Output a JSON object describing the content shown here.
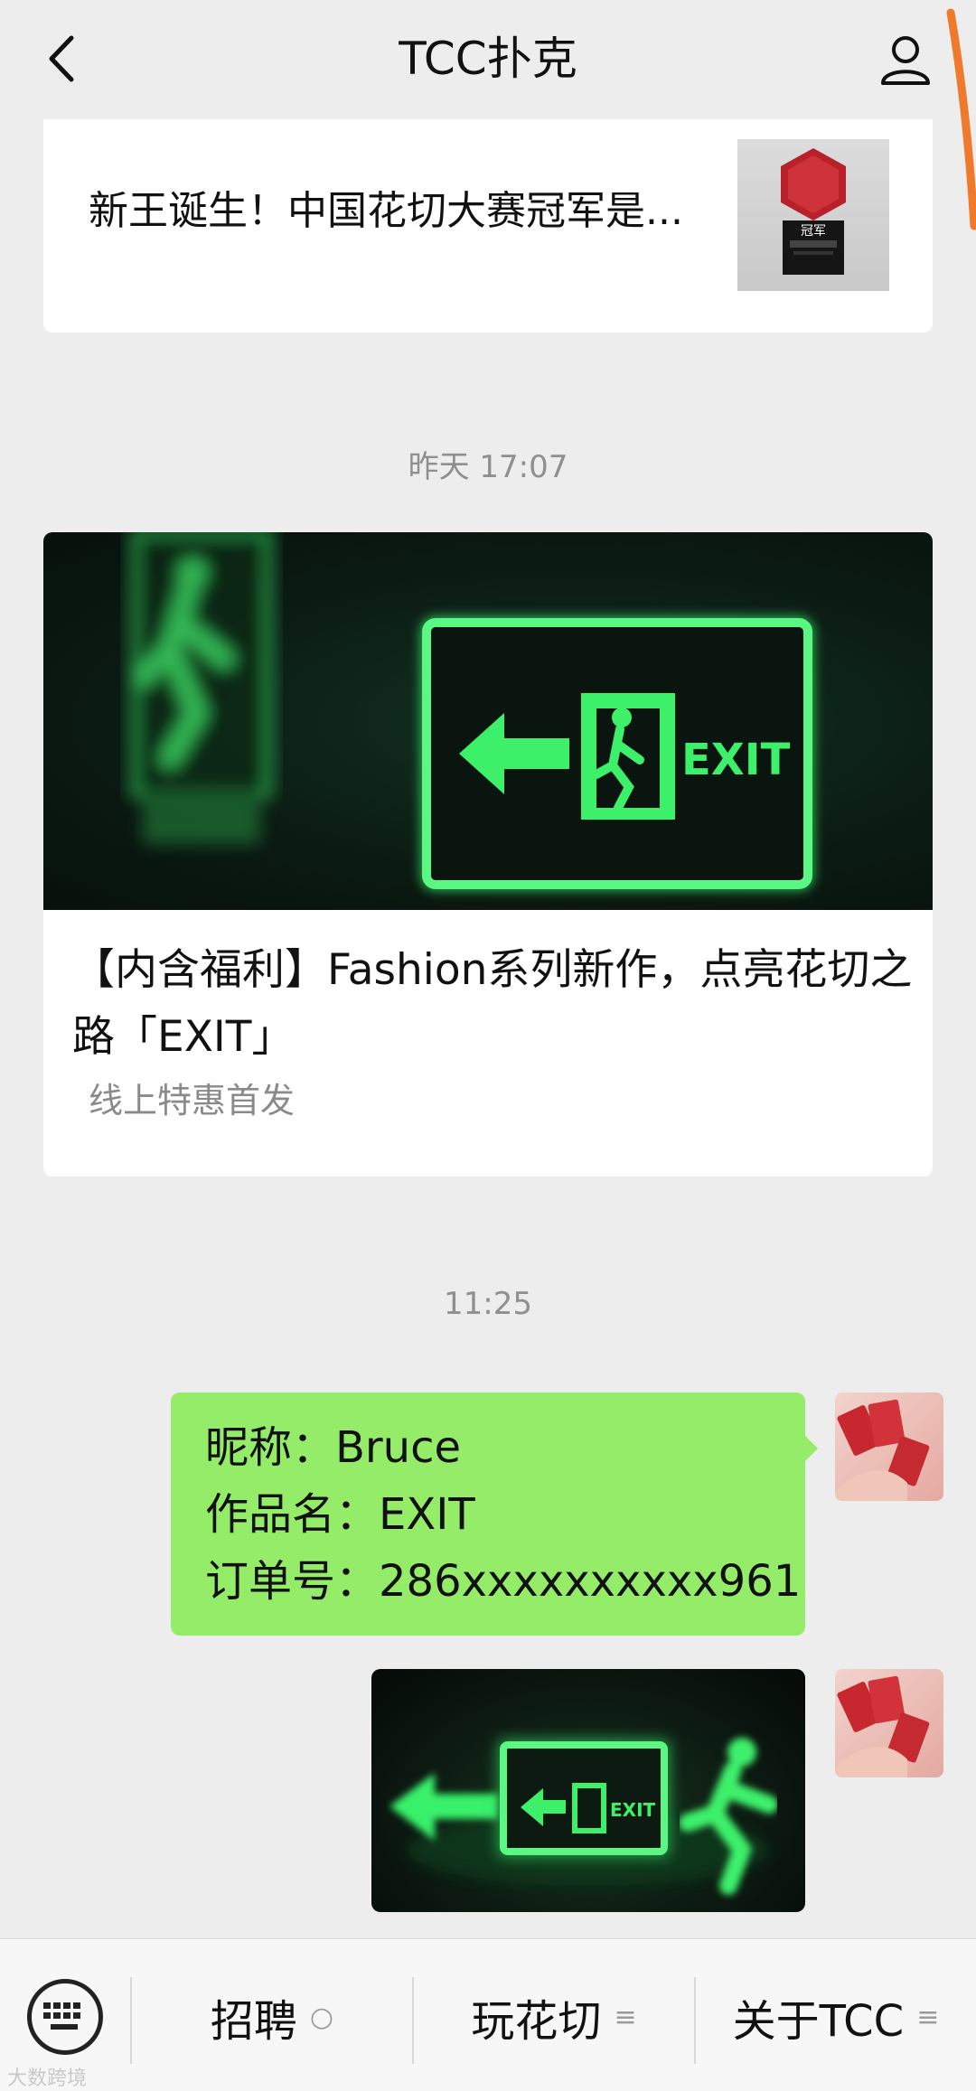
{
  "header": {
    "title": "TCC扑克"
  },
  "articles": {
    "first": {
      "title": "新王诞生！中国花切大赛冠军是...",
      "thumb_text": "冠军"
    },
    "second": {
      "timestamp": "昨天 17:07",
      "cover_sign_text": "EXIT",
      "title": "【内含福利】Fashion系列新作，点亮花切之路「EXIT」",
      "subtitle": "线上特惠首发"
    }
  },
  "chat": {
    "timestamp": "11:25",
    "message_lines": [
      "昵称：Bruce",
      "作品名：EXIT",
      "订单号：286xxxxxxxxxx961"
    ],
    "image_sign_text": "EXIT"
  },
  "bottom_menu": {
    "items": [
      {
        "label": "招聘",
        "mark": "○"
      },
      {
        "label": "玩花切",
        "mark": "≡"
      },
      {
        "label": "关于TCC",
        "mark": "≡"
      }
    ]
  },
  "watermark": "大数跨境",
  "colors": {
    "bubble": "#95ec69",
    "neon_green": "#38f06a",
    "background": "#ededed"
  }
}
